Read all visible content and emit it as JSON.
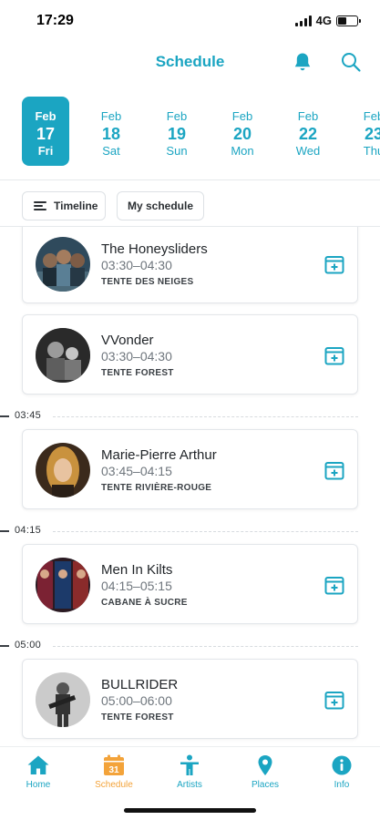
{
  "status_bar": {
    "time": "17:29",
    "network": "4G"
  },
  "header": {
    "title": "Schedule"
  },
  "dates": [
    {
      "month": "Feb",
      "day": "17",
      "weekday": "Fri",
      "selected": true
    },
    {
      "month": "Feb",
      "day": "18",
      "weekday": "Sat"
    },
    {
      "month": "Feb",
      "day": "19",
      "weekday": "Sun"
    },
    {
      "month": "Feb",
      "day": "20",
      "weekday": "Mon"
    },
    {
      "month": "Feb",
      "day": "22",
      "weekday": "Wed"
    },
    {
      "month": "Feb",
      "day": "23",
      "weekday": "Thu"
    }
  ],
  "filters": {
    "timeline_label": "Timeline",
    "my_schedule_label": "My schedule"
  },
  "time_markers": [
    "03:45",
    "04:15",
    "05:00"
  ],
  "events": [
    {
      "name": "The Honeysliders",
      "time": "03:30–04:30",
      "place": "TENTE DES NEIGES"
    },
    {
      "name": "VVonder",
      "time": "03:30–04:30",
      "place": "TENTE FOREST"
    },
    {
      "name": "Marie-Pierre Arthur",
      "time": "03:45–04:15",
      "place": "TENTE RIVIÈRE-ROUGE"
    },
    {
      "name": "Men In Kilts",
      "time": "04:15–05:15",
      "place": "CABANE À SUCRE"
    },
    {
      "name": "BULLRIDER",
      "time": "05:00–06:00",
      "place": "TENTE FOREST"
    }
  ],
  "tabs": [
    {
      "label": "Home",
      "icon": "home-icon"
    },
    {
      "label": "Schedule",
      "icon": "calendar-icon",
      "active": true,
      "badge": "31"
    },
    {
      "label": "Artists",
      "icon": "person-icon"
    },
    {
      "label": "Places",
      "icon": "map-pin-icon"
    },
    {
      "label": "Info",
      "icon": "info-icon"
    }
  ],
  "colors": {
    "accent": "#1ba5c2",
    "active_tab": "#f3a33a"
  }
}
